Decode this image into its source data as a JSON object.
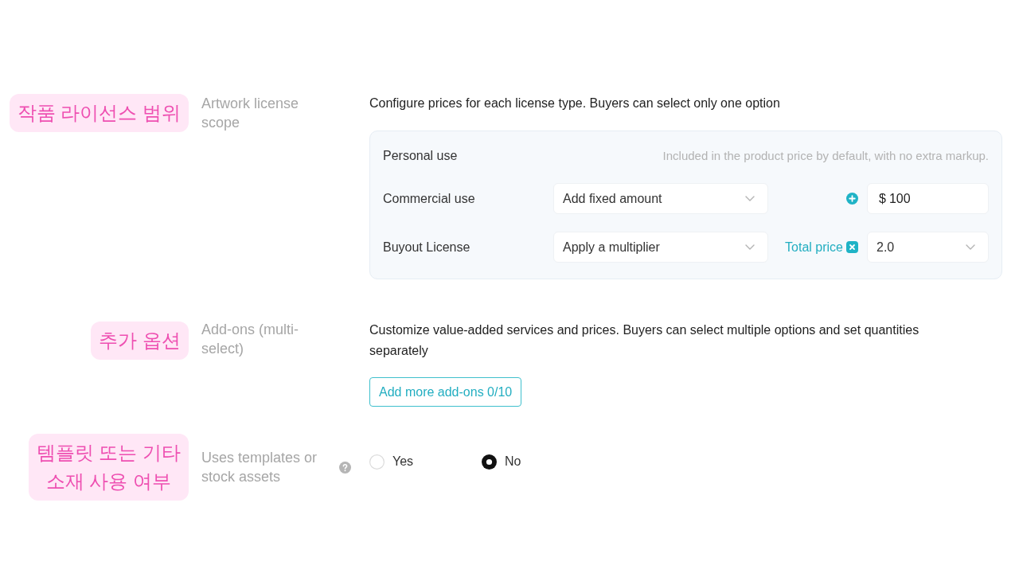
{
  "sections": [
    {
      "kind": "license_pricing",
      "annotation": "작품 라이선스 범위",
      "label": "Artwork license scope",
      "description": "Configure prices for each license type. Buyers can select only one option",
      "rows": [
        {
          "kind": "included",
          "name": "Personal use",
          "note": "Included in the product price by default, with no extra markup."
        },
        {
          "kind": "fixed_amount",
          "name": "Commercial use",
          "method": "Add fixed amount",
          "currency": "$",
          "amount": "100"
        },
        {
          "kind": "multiplier",
          "name": "Buyout License",
          "method": "Apply a multiplier",
          "result_label": "Total price",
          "factor": "2.0"
        }
      ]
    },
    {
      "kind": "addons",
      "annotation": "추가 옵션",
      "label": "Add-ons (multi-select)",
      "description": "Customize value-added services and prices. Buyers can select multiple options and set quantities separately",
      "button": "Add more add-ons 0/10"
    },
    {
      "kind": "choice",
      "annotation": "템플릿 또는 기타\n소재 사용 여부",
      "label": "Uses templates or stock assets",
      "options": [
        {
          "label": "Yes",
          "selected": false
        },
        {
          "label": "No",
          "selected": true
        }
      ]
    }
  ]
}
